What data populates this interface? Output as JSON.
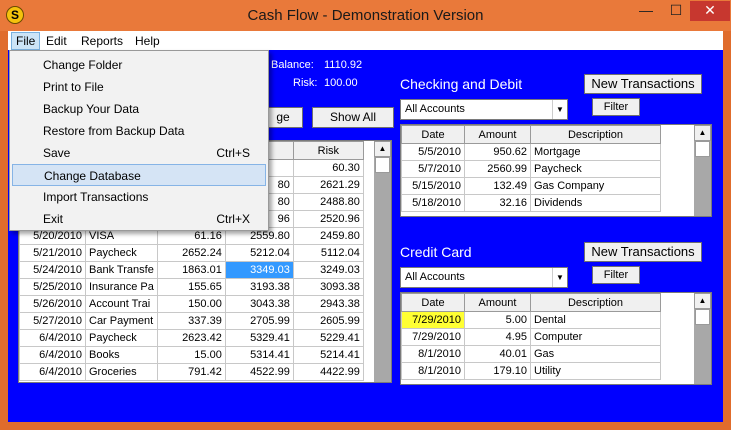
{
  "window": {
    "title": "Cash Flow - Demonstration Version",
    "app_icon_glyph": "S",
    "min_glyph": "—",
    "max_glyph": "☐",
    "close_glyph": "✕"
  },
  "menubar": {
    "file": "File",
    "edit": "Edit",
    "reports": "Reports",
    "help": "Help"
  },
  "file_menu": {
    "items": [
      {
        "label": "Change Folder",
        "shortcut": ""
      },
      {
        "label": "Print to File",
        "shortcut": ""
      },
      {
        "label": "Backup Your Data",
        "shortcut": ""
      },
      {
        "label": "Restore from Backup Data",
        "shortcut": ""
      },
      {
        "label": "Save",
        "shortcut": "Ctrl+S"
      },
      {
        "label": "Change Database",
        "shortcut": ""
      },
      {
        "label": "Import Transactions",
        "shortcut": ""
      },
      {
        "label": "Exit",
        "shortcut": "Ctrl+X"
      }
    ]
  },
  "summary": {
    "balance_label": "Balance:",
    "balance_value": "1110.92",
    "risk_label": "Risk:",
    "risk_value": "100.00",
    "partial_button": "ge",
    "show_all_button": "Show All"
  },
  "main_grid": {
    "risk_header": "Risk",
    "rows": [
      {
        "date": "",
        "desc": "",
        "amount": "",
        "balance": "",
        "risk": "60.30"
      },
      {
        "date": "",
        "desc": "",
        "amount": "",
        "balance": "80",
        "risk": "2621.29"
      },
      {
        "date": "",
        "desc": "",
        "amount": "",
        "balance": "80",
        "risk": "2488.80"
      },
      {
        "date": "",
        "desc": "",
        "amount": "",
        "balance": "96",
        "risk": "2520.96"
      },
      {
        "date": "5/20/2010",
        "desc": "VISA",
        "amount": "61.16",
        "balance": "2559.80",
        "risk": "2459.80"
      },
      {
        "date": "5/21/2010",
        "desc": "Paycheck",
        "amount": "2652.24",
        "balance": "5212.04",
        "risk": "5112.04"
      },
      {
        "date": "5/24/2010",
        "desc": "Bank Transfe",
        "amount": "1863.01",
        "balance": "3349.03",
        "risk": "3249.03"
      },
      {
        "date": "5/25/2010",
        "desc": "Insurance Pa",
        "amount": "155.65",
        "balance": "3193.38",
        "risk": "3093.38"
      },
      {
        "date": "5/26/2010",
        "desc": "Account Trai",
        "amount": "150.00",
        "balance": "3043.38",
        "risk": "2943.38"
      },
      {
        "date": "5/27/2010",
        "desc": "Car Payment",
        "amount": "337.39",
        "balance": "2705.99",
        "risk": "2605.99"
      },
      {
        "date": "6/4/2010",
        "desc": "Paycheck",
        "amount": "2623.42",
        "balance": "5329.41",
        "risk": "5229.41"
      },
      {
        "date": "6/4/2010",
        "desc": "Books",
        "amount": "15.00",
        "balance": "5314.41",
        "risk": "5214.41"
      },
      {
        "date": "6/4/2010",
        "desc": "Groceries",
        "amount": "791.42",
        "balance": "4522.99",
        "risk": "4422.99"
      }
    ]
  },
  "checking": {
    "title": "Checking and Debit",
    "new_button": "New Transactions",
    "filter_button": "Filter",
    "account_select": "All Accounts",
    "headers": [
      "Date",
      "Amount",
      "Description"
    ],
    "rows": [
      {
        "date": "5/5/2010",
        "amount": "950.62",
        "desc": "Mortgage"
      },
      {
        "date": "5/7/2010",
        "amount": "2560.99",
        "desc": "Paycheck"
      },
      {
        "date": "5/15/2010",
        "amount": "132.49",
        "desc": "Gas Company"
      },
      {
        "date": "5/18/2010",
        "amount": "32.16",
        "desc": "Dividends"
      }
    ]
  },
  "credit": {
    "title": "Credit Card",
    "new_button": "New Transactions",
    "filter_button": "Filter",
    "account_select": "All Accounts",
    "headers": [
      "Date",
      "Amount",
      "Description"
    ],
    "rows": [
      {
        "date": "7/29/2010",
        "amount": "5.00",
        "desc": "Dental"
      },
      {
        "date": "7/29/2010",
        "amount": "4.95",
        "desc": "Computer"
      },
      {
        "date": "8/1/2010",
        "amount": "40.01",
        "desc": "Gas"
      },
      {
        "date": "8/1/2010",
        "amount": "179.10",
        "desc": "Utility"
      }
    ]
  },
  "colors": {
    "client_bg": "#0000ff",
    "titlebar": "#e9793a",
    "highlight_yellow": "#ffff33",
    "highlight_blue": "#3399ff"
  },
  "icons": [
    "app-icon",
    "minimize-icon",
    "maximize-icon",
    "close-icon",
    "dropdown-arrow-icon",
    "scroll-up-icon",
    "scroll-down-icon"
  ]
}
